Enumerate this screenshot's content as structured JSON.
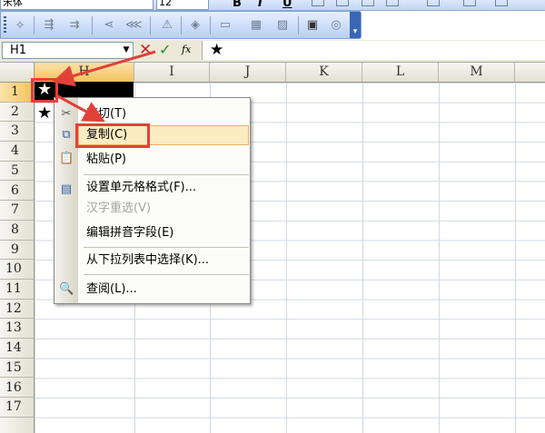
{
  "toolbar": {
    "font_name": "宋体",
    "font_size": "12",
    "bold_label": "B",
    "italic_label": "I",
    "underline_label": "U"
  },
  "formula_bar": {
    "name_box": "H1",
    "cancel_icon": "✕",
    "enter_icon": "✓",
    "function_label": "fx",
    "content": "★"
  },
  "columns": [
    {
      "label": "H",
      "selected": true
    },
    {
      "label": "I",
      "selected": false
    },
    {
      "label": "J",
      "selected": false
    },
    {
      "label": "K",
      "selected": false
    },
    {
      "label": "L",
      "selected": false
    },
    {
      "label": "M",
      "selected": false
    }
  ],
  "rows": [
    "1",
    "2",
    "3",
    "4",
    "5",
    "6",
    "7",
    "8",
    "9",
    "10",
    "11",
    "12",
    "13",
    "14",
    "15",
    "16",
    "17"
  ],
  "cells": {
    "h1": "★",
    "h2": "★"
  },
  "context_menu": {
    "items": [
      {
        "label": "剪切(T)",
        "icon": "scissors-icon",
        "disabled": false,
        "highlighted": false
      },
      {
        "label": "复制(C)",
        "icon": "copy-icon",
        "disabled": false,
        "highlighted": true
      },
      {
        "label": "粘贴(P)",
        "icon": "paste-icon",
        "disabled": false,
        "highlighted": false
      },
      {
        "label": "设置单元格格式(F)...",
        "icon": "format-cells-icon",
        "disabled": false,
        "highlighted": false
      },
      {
        "label": "汉字重选(V)",
        "icon": "",
        "disabled": true,
        "highlighted": false
      },
      {
        "label": "编辑拼音字段(E)",
        "icon": "",
        "disabled": false,
        "highlighted": false
      },
      {
        "label": "从下拉列表中选择(K)...",
        "icon": "",
        "disabled": false,
        "highlighted": false
      },
      {
        "label": "查阅(L)...",
        "icon": "research-icon",
        "disabled": false,
        "highlighted": false
      }
    ]
  },
  "colors": {
    "highlight_red": "#e2413a",
    "menu_hover": "#fcecc2",
    "selection_header": "#f3c35d"
  }
}
